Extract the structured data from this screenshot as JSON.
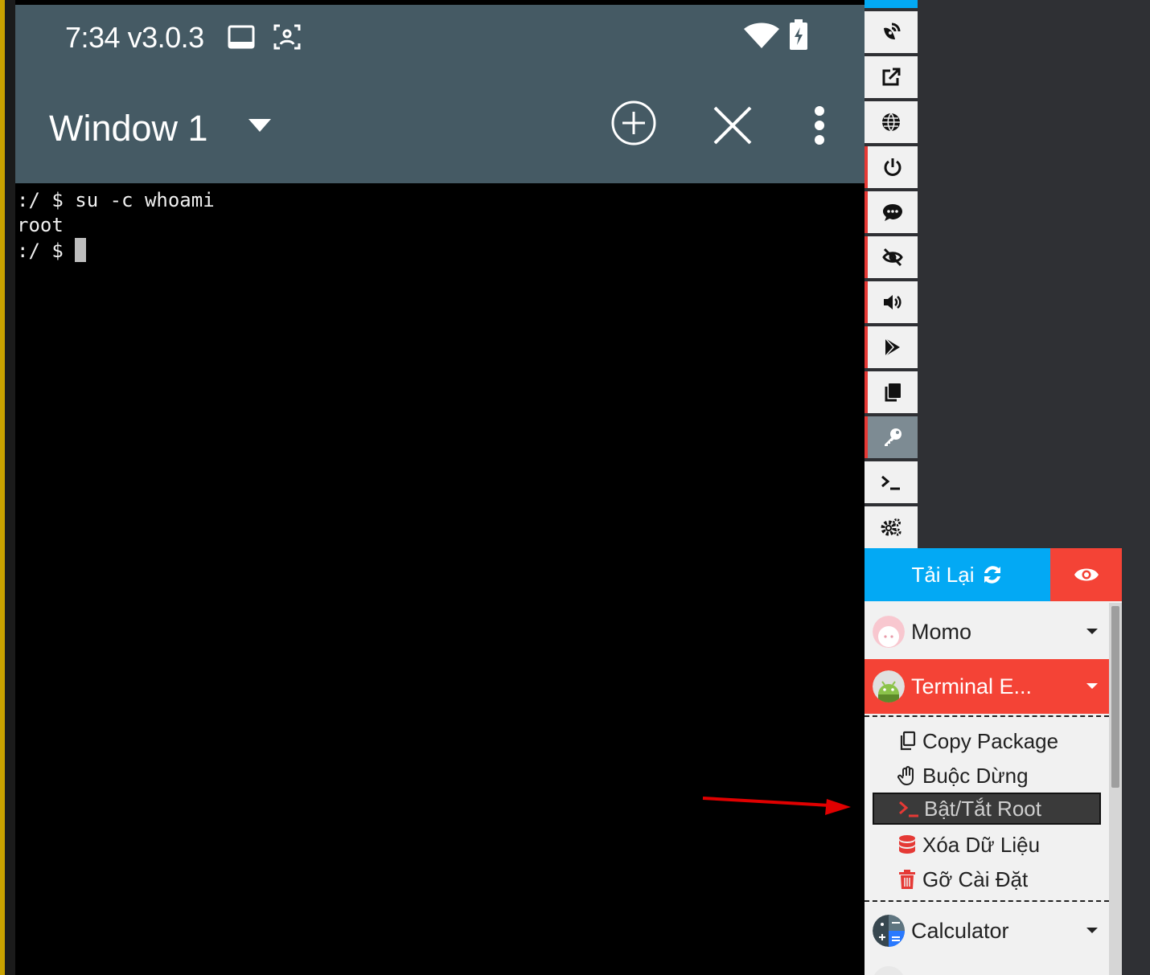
{
  "status_bar": {
    "time_version": "7:34 v3.0.3"
  },
  "app_bar": {
    "window_title": "Window 1"
  },
  "terminal": {
    "lines": [
      ":/ $ su -c whoami",
      "root",
      ":/ $ "
    ]
  },
  "toolbar": {
    "icons": [
      "satellite-dish-icon",
      "external-link-icon",
      "globe-icon",
      "power-icon",
      "comment-dots-icon",
      "eye-slash-icon",
      "volume-icon",
      "google-play-icon",
      "copy-icon",
      "key-icon",
      "terminal-icon",
      "cogs-icon"
    ],
    "active": "key-icon"
  },
  "panel": {
    "reload_label": "Tải Lại",
    "apps": [
      {
        "name": "Momo",
        "selected": false
      },
      {
        "name": "Terminal E...",
        "selected": true
      },
      {
        "name": "Calculator",
        "selected": false
      }
    ],
    "submenu": [
      {
        "label": "Copy Package",
        "icon": "copy-icon"
      },
      {
        "label": "Buộc Dừng",
        "icon": "hand-paper-icon"
      },
      {
        "label": "Bật/Tắt Root",
        "icon": "terminal-icon",
        "highlighted": true
      },
      {
        "label": "Xóa Dữ Liệu",
        "icon": "database-icon"
      },
      {
        "label": "Gỡ Cài Đặt",
        "icon": "trash-icon"
      }
    ]
  },
  "colors": {
    "status_bar": "#455a64",
    "accent_blue": "#03a9f4",
    "accent_red": "#f44336",
    "highlight_bg": "#3a3a3a",
    "annotation_arrow": "#e00000"
  }
}
